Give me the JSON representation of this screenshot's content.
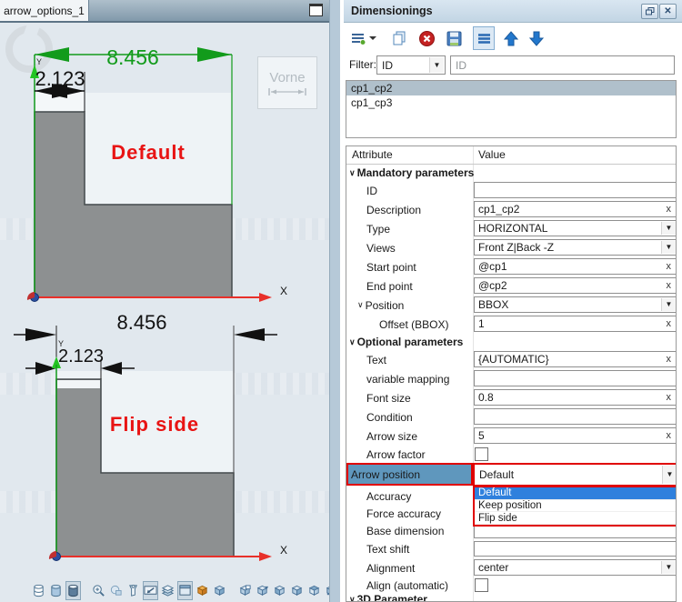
{
  "viewport": {
    "tab_title": "arrow_options_1",
    "view_label": "Vorne",
    "drawings": [
      {
        "caption": "Default",
        "width_dim": "8.456",
        "small_dim": "2.123",
        "x_axis_label": "X",
        "y_axis_label": "Y"
      },
      {
        "caption": "Flip side",
        "width_dim": "8.456",
        "small_dim": "2.123",
        "x_axis_label": "X",
        "y_axis_label": "Y"
      }
    ],
    "bottom_toolbar_icons": [
      "cylinder-outline-icon",
      "cylinder-shaded-icon",
      "cylinder-dark-icon",
      "zoom-in-icon",
      "zoom-previous-icon",
      "zoom-selection-icon",
      "fit-screen-icon",
      "render-modes-icon",
      "viewport-window-icon",
      "solid-view-icon",
      "transparent-view-icon",
      "back-view-icon",
      "front-view-icon",
      "left-view-icon",
      "right-view-icon",
      "top-view-icon",
      "bottom-view-icon",
      "isometric-view-icon",
      "view-options-icon"
    ]
  },
  "panel": {
    "title": "Dimensionings",
    "toolbar_icons": [
      "menu-icon",
      "copy-icon",
      "delete-icon",
      "save-icon",
      "list-view-icon",
      "move-up-icon",
      "move-down-icon"
    ],
    "filter_label": "Filter:",
    "filter_field": "ID",
    "filter_placeholder": "ID",
    "list_items": [
      "cp1_cp2",
      "cp1_cp3"
    ],
    "selected_item": "cp1_cp2",
    "clear_glyph": "x",
    "table": {
      "headers": [
        "Attribute",
        "Value"
      ],
      "rows": [
        {
          "label": "Mandatory parameters",
          "type": "section"
        },
        {
          "label": "ID",
          "type": "input",
          "value": ""
        },
        {
          "label": "Description",
          "type": "input",
          "value": "cp1_cp2"
        },
        {
          "label": "Type",
          "type": "combo",
          "value": "HORIZONTAL"
        },
        {
          "label": "Views",
          "type": "combo",
          "value": "Front Z|Back -Z"
        },
        {
          "label": "Start point",
          "type": "input",
          "value": "@cp1"
        },
        {
          "label": "End point",
          "type": "input",
          "value": "@cp2"
        },
        {
          "label": "Position",
          "type": "combo",
          "value": "BBOX"
        },
        {
          "label": "Offset (BBOX)",
          "type": "input",
          "value": "1"
        },
        {
          "label": "Optional parameters",
          "type": "section"
        },
        {
          "label": "Text",
          "type": "input",
          "value": "{AUTOMATIC}"
        },
        {
          "label": "variable mapping",
          "type": "input",
          "value": ""
        },
        {
          "label": "Font size",
          "type": "input",
          "value": "0.8"
        },
        {
          "label": "Condition",
          "type": "input",
          "value": ""
        },
        {
          "label": "Arrow size",
          "type": "input",
          "value": "5"
        },
        {
          "label": "Arrow factor",
          "type": "checkbox",
          "checked": false
        },
        {
          "label": "Arrow position",
          "type": "combo",
          "value": "Default",
          "highlighted": true
        },
        {
          "label": "Accuracy",
          "type": "input",
          "value": ""
        },
        {
          "label": "Force accuracy",
          "type": "input",
          "value": ""
        },
        {
          "label": "Base dimension",
          "type": "input",
          "value": ""
        },
        {
          "label": "Text shift",
          "type": "input",
          "value": ""
        },
        {
          "label": "Alignment",
          "type": "combo",
          "value": "center"
        },
        {
          "label": "Align (automatic)",
          "type": "checkbox",
          "checked": false
        },
        {
          "label": "3D Parameter",
          "type": "section"
        }
      ]
    },
    "dropdown": {
      "selected": "Default",
      "options": [
        "Default",
        "Keep position",
        "Flip side"
      ]
    }
  },
  "colors": {
    "dimension_green": "#129b1b",
    "axis_red": "#e8302a",
    "annotation_red": "#e81414",
    "selection_blue": "#2f80dd",
    "highlight_cell_blue": "#5f97bd",
    "outline_red": "#e00000",
    "list_selection": "#b0c0cb",
    "shape_gray": "#8d9091"
  }
}
